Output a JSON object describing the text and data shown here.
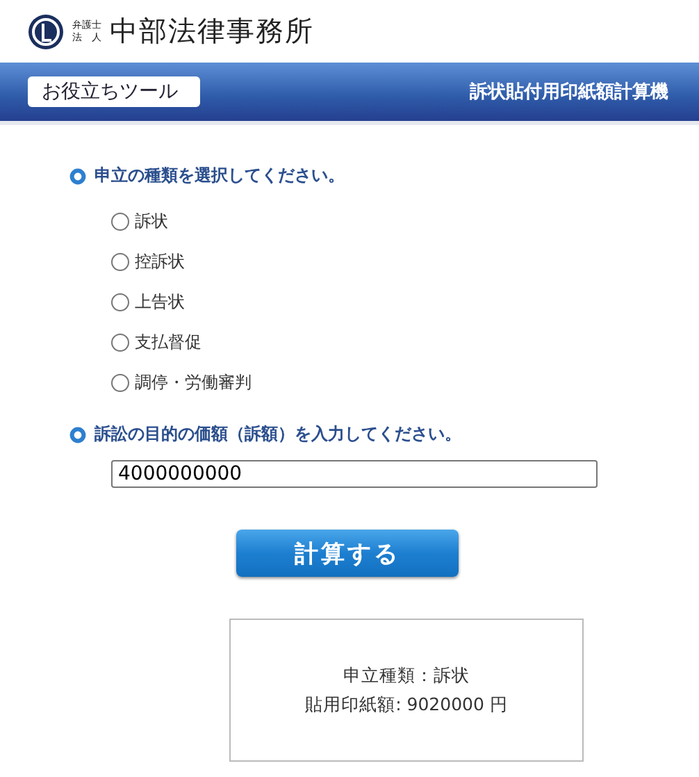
{
  "header": {
    "firm_label": [
      "弁護士",
      "法　人"
    ],
    "firm_name": "中部法律事務所"
  },
  "banner": {
    "badge": "お役立ちツール",
    "title": "訴状貼付用印紙額計算機"
  },
  "type_section": {
    "heading": "申立の種類を選択してください。",
    "options": [
      {
        "label": "訴状",
        "selected": false
      },
      {
        "label": "控訴状",
        "selected": false
      },
      {
        "label": "上告状",
        "selected": false
      },
      {
        "label": "支払督促",
        "selected": false
      },
      {
        "label": "調停・労働審判",
        "selected": false
      }
    ]
  },
  "amount_section": {
    "heading": "訴訟の目的の価額（訴額）を入力してください。",
    "value": "4000000000"
  },
  "calculate_button": "計算する",
  "result": {
    "lines": [
      "申立種類：訴状",
      "貼用印紙額: 9020000 円"
    ]
  }
}
